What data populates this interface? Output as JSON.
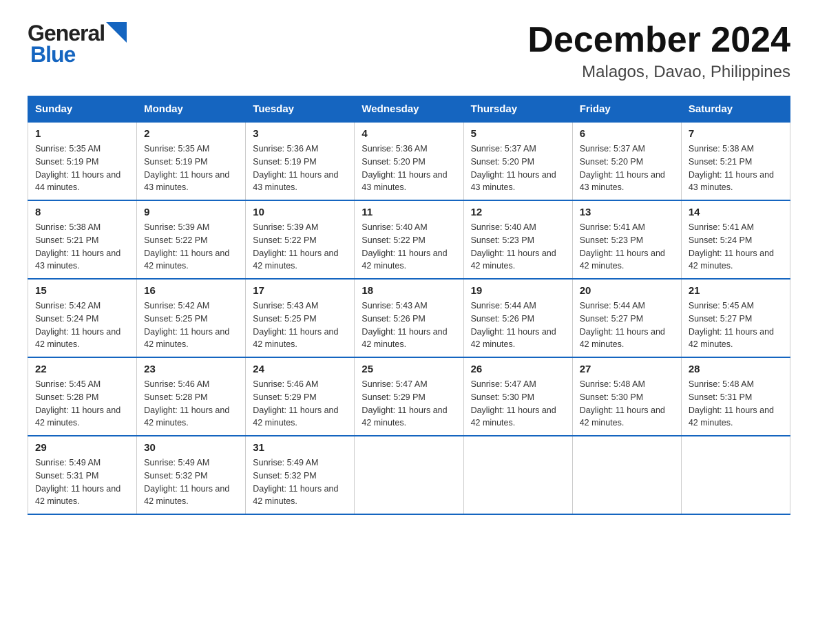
{
  "header": {
    "logo_general": "General",
    "logo_blue": "Blue",
    "title": "December 2024",
    "subtitle": "Malagos, Davao, Philippines"
  },
  "weekdays": [
    "Sunday",
    "Monday",
    "Tuesday",
    "Wednesday",
    "Thursday",
    "Friday",
    "Saturday"
  ],
  "weeks": [
    [
      {
        "day": "1",
        "sunrise": "5:35 AM",
        "sunset": "5:19 PM",
        "daylight": "11 hours and 44 minutes."
      },
      {
        "day": "2",
        "sunrise": "5:35 AM",
        "sunset": "5:19 PM",
        "daylight": "11 hours and 43 minutes."
      },
      {
        "day": "3",
        "sunrise": "5:36 AM",
        "sunset": "5:19 PM",
        "daylight": "11 hours and 43 minutes."
      },
      {
        "day": "4",
        "sunrise": "5:36 AM",
        "sunset": "5:20 PM",
        "daylight": "11 hours and 43 minutes."
      },
      {
        "day": "5",
        "sunrise": "5:37 AM",
        "sunset": "5:20 PM",
        "daylight": "11 hours and 43 minutes."
      },
      {
        "day": "6",
        "sunrise": "5:37 AM",
        "sunset": "5:20 PM",
        "daylight": "11 hours and 43 minutes."
      },
      {
        "day": "7",
        "sunrise": "5:38 AM",
        "sunset": "5:21 PM",
        "daylight": "11 hours and 43 minutes."
      }
    ],
    [
      {
        "day": "8",
        "sunrise": "5:38 AM",
        "sunset": "5:21 PM",
        "daylight": "11 hours and 43 minutes."
      },
      {
        "day": "9",
        "sunrise": "5:39 AM",
        "sunset": "5:22 PM",
        "daylight": "11 hours and 42 minutes."
      },
      {
        "day": "10",
        "sunrise": "5:39 AM",
        "sunset": "5:22 PM",
        "daylight": "11 hours and 42 minutes."
      },
      {
        "day": "11",
        "sunrise": "5:40 AM",
        "sunset": "5:22 PM",
        "daylight": "11 hours and 42 minutes."
      },
      {
        "day": "12",
        "sunrise": "5:40 AM",
        "sunset": "5:23 PM",
        "daylight": "11 hours and 42 minutes."
      },
      {
        "day": "13",
        "sunrise": "5:41 AM",
        "sunset": "5:23 PM",
        "daylight": "11 hours and 42 minutes."
      },
      {
        "day": "14",
        "sunrise": "5:41 AM",
        "sunset": "5:24 PM",
        "daylight": "11 hours and 42 minutes."
      }
    ],
    [
      {
        "day": "15",
        "sunrise": "5:42 AM",
        "sunset": "5:24 PM",
        "daylight": "11 hours and 42 minutes."
      },
      {
        "day": "16",
        "sunrise": "5:42 AM",
        "sunset": "5:25 PM",
        "daylight": "11 hours and 42 minutes."
      },
      {
        "day": "17",
        "sunrise": "5:43 AM",
        "sunset": "5:25 PM",
        "daylight": "11 hours and 42 minutes."
      },
      {
        "day": "18",
        "sunrise": "5:43 AM",
        "sunset": "5:26 PM",
        "daylight": "11 hours and 42 minutes."
      },
      {
        "day": "19",
        "sunrise": "5:44 AM",
        "sunset": "5:26 PM",
        "daylight": "11 hours and 42 minutes."
      },
      {
        "day": "20",
        "sunrise": "5:44 AM",
        "sunset": "5:27 PM",
        "daylight": "11 hours and 42 minutes."
      },
      {
        "day": "21",
        "sunrise": "5:45 AM",
        "sunset": "5:27 PM",
        "daylight": "11 hours and 42 minutes."
      }
    ],
    [
      {
        "day": "22",
        "sunrise": "5:45 AM",
        "sunset": "5:28 PM",
        "daylight": "11 hours and 42 minutes."
      },
      {
        "day": "23",
        "sunrise": "5:46 AM",
        "sunset": "5:28 PM",
        "daylight": "11 hours and 42 minutes."
      },
      {
        "day": "24",
        "sunrise": "5:46 AM",
        "sunset": "5:29 PM",
        "daylight": "11 hours and 42 minutes."
      },
      {
        "day": "25",
        "sunrise": "5:47 AM",
        "sunset": "5:29 PM",
        "daylight": "11 hours and 42 minutes."
      },
      {
        "day": "26",
        "sunrise": "5:47 AM",
        "sunset": "5:30 PM",
        "daylight": "11 hours and 42 minutes."
      },
      {
        "day": "27",
        "sunrise": "5:48 AM",
        "sunset": "5:30 PM",
        "daylight": "11 hours and 42 minutes."
      },
      {
        "day": "28",
        "sunrise": "5:48 AM",
        "sunset": "5:31 PM",
        "daylight": "11 hours and 42 minutes."
      }
    ],
    [
      {
        "day": "29",
        "sunrise": "5:49 AM",
        "sunset": "5:31 PM",
        "daylight": "11 hours and 42 minutes."
      },
      {
        "day": "30",
        "sunrise": "5:49 AM",
        "sunset": "5:32 PM",
        "daylight": "11 hours and 42 minutes."
      },
      {
        "day": "31",
        "sunrise": "5:49 AM",
        "sunset": "5:32 PM",
        "daylight": "11 hours and 42 minutes."
      },
      null,
      null,
      null,
      null
    ]
  ]
}
